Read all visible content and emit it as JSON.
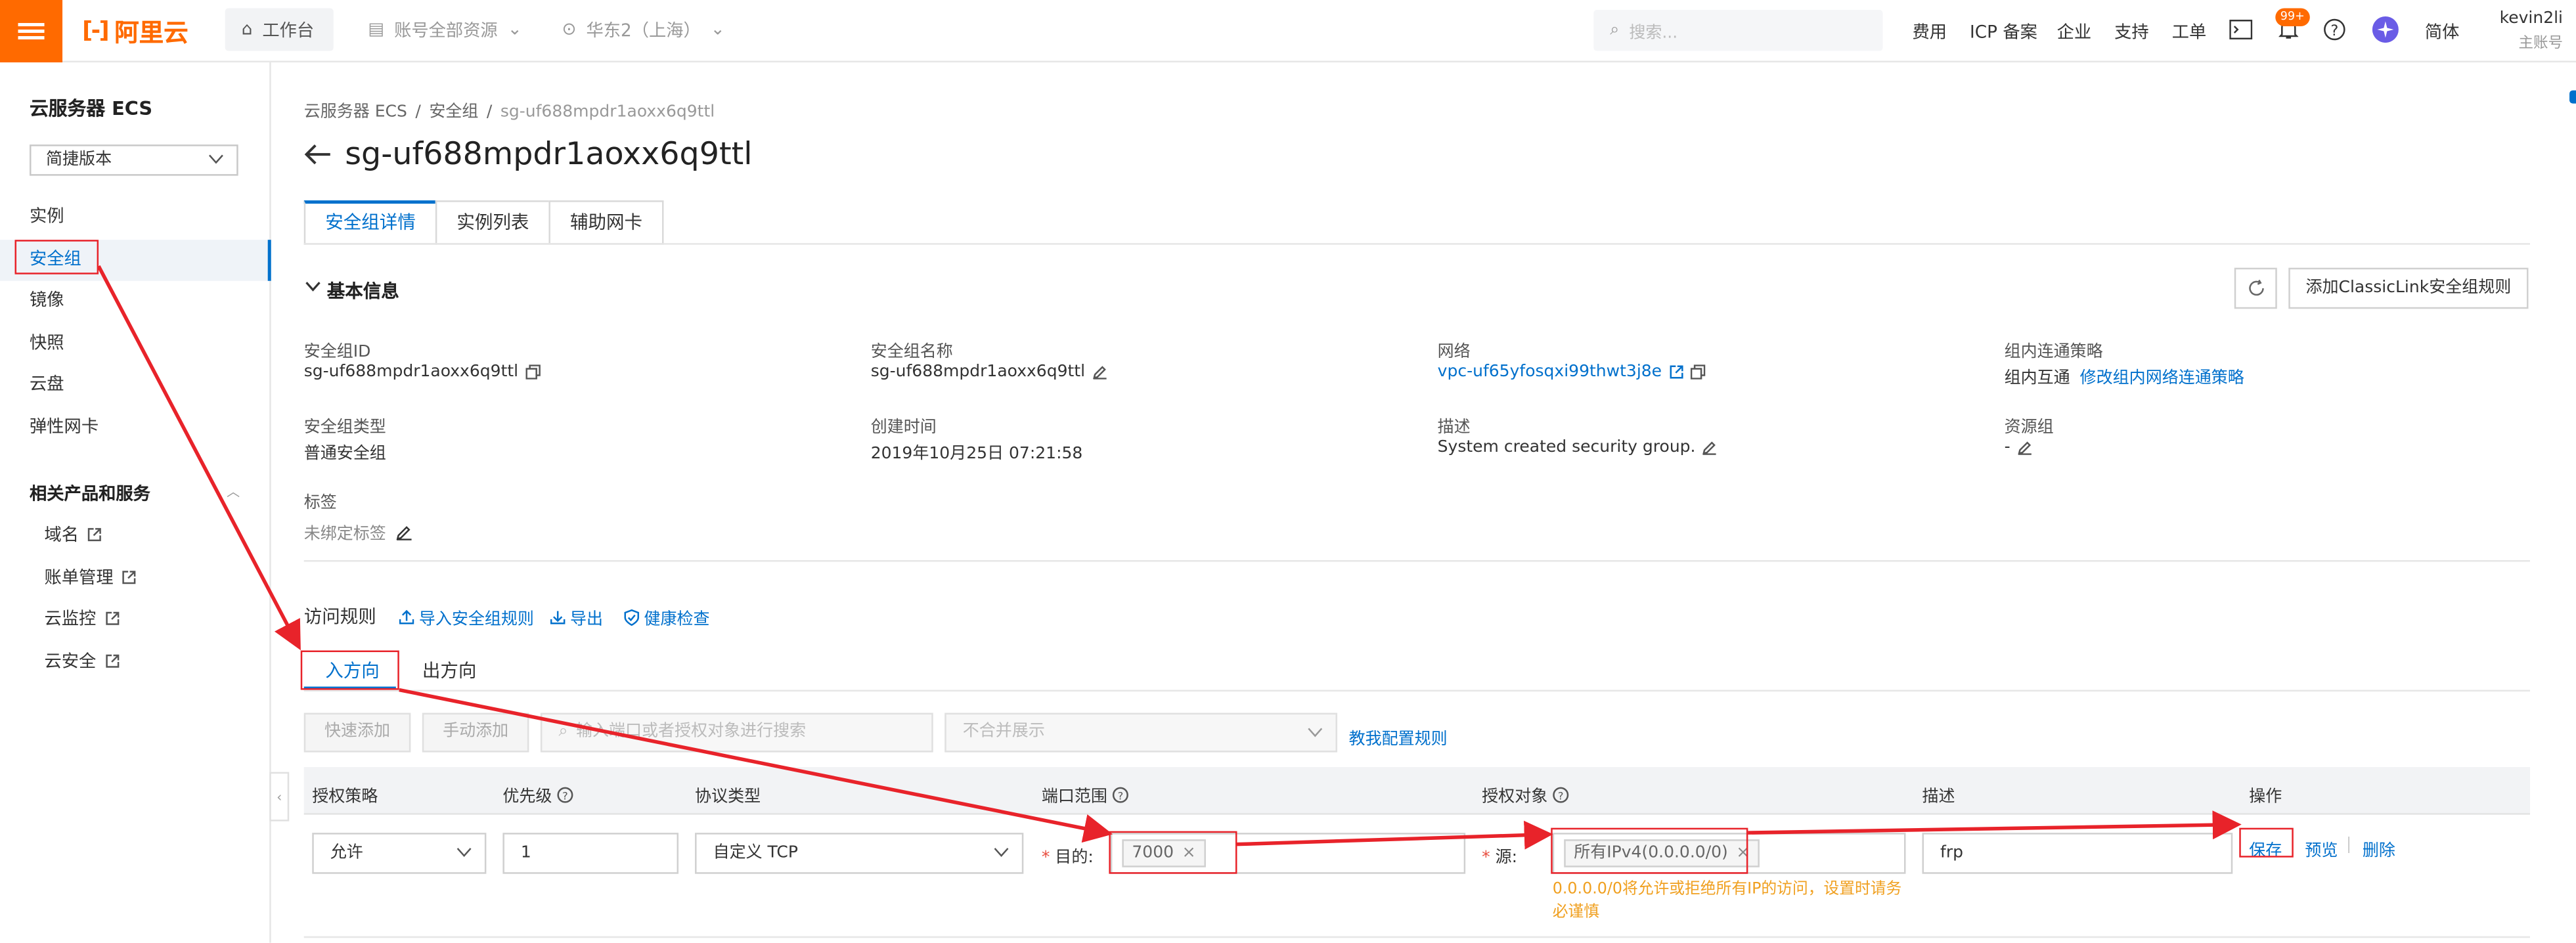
{
  "header": {
    "logo": "阿里云",
    "workspace": "工作台",
    "account_resources": "账号全部资源",
    "region": "华东2（上海）",
    "search_placeholder": "搜索...",
    "links": [
      "费用",
      "ICP 备案",
      "企业",
      "支持",
      "工单"
    ],
    "notif_badge": "99+",
    "language": "简体",
    "user_name": "kevin2li",
    "user_role": "主账号"
  },
  "sidebar": {
    "title": "云服务器 ECS",
    "version_select": "简捷版本",
    "items": [
      "实例",
      "安全组",
      "镜像",
      "快照",
      "云盘",
      "弹性网卡"
    ],
    "section_title": "相关产品和服务",
    "related": [
      "域名",
      "账单管理",
      "云监控",
      "云安全"
    ]
  },
  "breadcrumb": [
    "云服务器 ECS",
    "/",
    "安全组",
    "/",
    "sg-uf688mpdr1aoxx6q9ttl"
  ],
  "page_title": "sg-uf688mpdr1aoxx6q9ttl",
  "tabs": [
    "安全组详情",
    "实例列表",
    "辅助网卡"
  ],
  "basic": {
    "title": "基本信息",
    "classiclink_button": "添加ClassicLink安全组规则",
    "fields": {
      "sg_id_label": "安全组ID",
      "sg_id": "sg-uf688mpdr1aoxx6q9ttl",
      "sg_name_label": "安全组名称",
      "sg_name": "sg-uf688mpdr1aoxx6q9ttl",
      "network_label": "网络",
      "network": "vpc-uf65yfosqxi99thwt3j8e",
      "intra_label": "组内连通策略",
      "intra": "组内互通",
      "intra_link": "修改组内网络连通策略",
      "type_label": "安全组类型",
      "type": "普通安全组",
      "created_label": "创建时间",
      "created": "2019年10月25日 07:21:58",
      "desc_label": "描述",
      "desc": "System created security group.",
      "rg_label": "资源组",
      "rg": "-",
      "tag_label": "标签",
      "tag": "未绑定标签"
    }
  },
  "rules": {
    "title": "访问规则",
    "actions": [
      "导入安全组规则",
      "导出",
      "健康检查"
    ],
    "directions": [
      "入方向",
      "出方向"
    ],
    "quick_add": "快速添加",
    "manual_add": "手动添加",
    "search_placeholder": "输入端口或者授权对象进行搜索",
    "merge_select": "不合并展示",
    "tutorial": "教我配置规则",
    "columns": [
      "授权策略",
      "优先级",
      "协议类型",
      "端口范围",
      "授权对象",
      "描述",
      "操作"
    ],
    "row": {
      "policy": "允许",
      "priority": "1",
      "protocol": "自定义 TCP",
      "dest_label": "目的:",
      "port": "7000",
      "src_label": "源:",
      "source": "所有IPv4(0.0.0.0/0)",
      "description": "frp",
      "op_save": "保存",
      "op_preview": "预览",
      "op_delete": "删除",
      "op_sep": "|",
      "warning": "0.0.0.0/0将允许或拒绝所有IP的访问，设置时请务必谨慎"
    }
  },
  "colors": {
    "accent": "#ff6a00",
    "link": "#0070cc",
    "annotation": "#e8232a",
    "warning": "#f0a020"
  }
}
